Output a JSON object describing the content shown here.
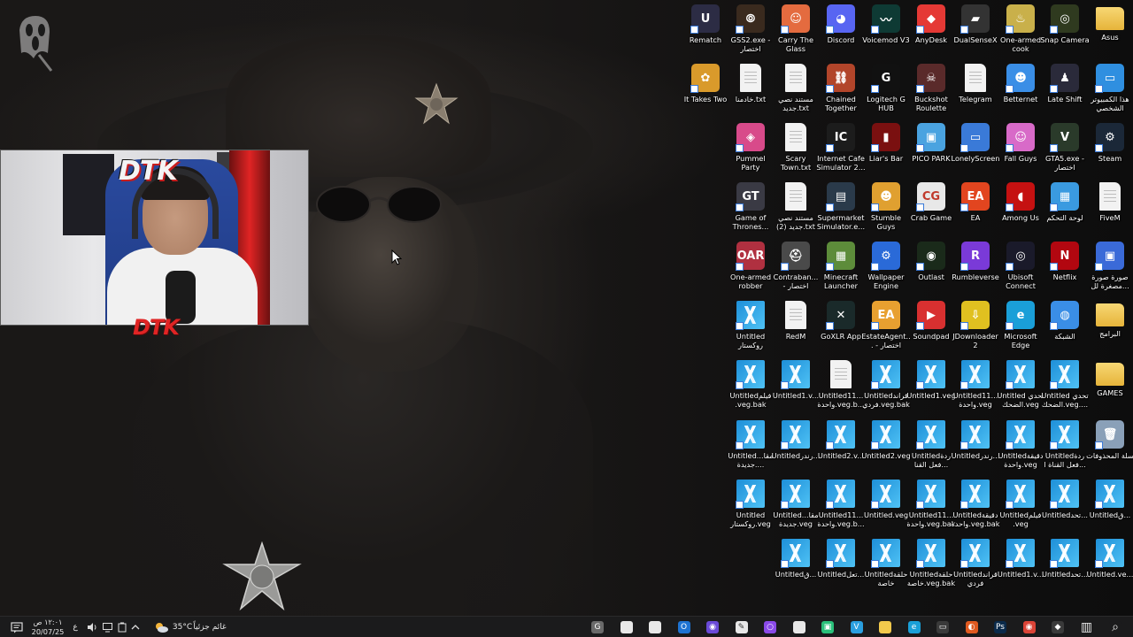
{
  "desktop": {
    "icons": [
      {
        "label": "Rematch",
        "kind": "app",
        "color": "#2c2c44",
        "glyph": "U",
        "col": 0,
        "row": 0
      },
      {
        "label": "GSS2.exe - اختصار",
        "kind": "app",
        "color": "#3a2a1e",
        "glyph": "⦾",
        "col": 1,
        "row": 0
      },
      {
        "label": "Carry The Glass",
        "kind": "app",
        "color": "#e46b3f",
        "glyph": "☺",
        "col": 2,
        "row": 0
      },
      {
        "label": "Discord",
        "kind": "app",
        "color": "#5865f2",
        "glyph": "◕",
        "col": 3,
        "row": 0
      },
      {
        "label": "Voicemod V3",
        "kind": "app",
        "color": "#0e3a34",
        "glyph": "〰",
        "col": 4,
        "row": 0
      },
      {
        "label": "AnyDesk",
        "kind": "app",
        "color": "#e53935",
        "glyph": "◆",
        "col": 5,
        "row": 0
      },
      {
        "label": "DualSenseX",
        "kind": "app",
        "color": "#333333",
        "glyph": "▰",
        "col": 6,
        "row": 0
      },
      {
        "label": "One-armed cook",
        "kind": "app",
        "color": "#c9b04a",
        "glyph": "♨",
        "col": 7,
        "row": 0
      },
      {
        "label": "Snap Camera",
        "kind": "app",
        "color": "#2f3a1f",
        "glyph": "◎",
        "col": 8,
        "row": 0
      },
      {
        "label": "Asus",
        "kind": "folder",
        "color": "#f2c94c",
        "glyph": "",
        "col": 9,
        "row": 0
      },
      {
        "label": "It Takes Two",
        "kind": "app",
        "color": "#d99a2b",
        "glyph": "✿",
        "col": 0,
        "row": 1
      },
      {
        "label": "خادمنا.txt",
        "kind": "doc",
        "color": "#f2f2f2",
        "glyph": "",
        "col": 1,
        "row": 1
      },
      {
        "label": "مستند نصي جديد.txt",
        "kind": "doc",
        "color": "#f2f2f2",
        "glyph": "",
        "col": 2,
        "row": 1
      },
      {
        "label": "Chained Together",
        "kind": "app",
        "color": "#b2452a",
        "glyph": "⛓",
        "col": 3,
        "row": 1
      },
      {
        "label": "Logitech G HUB",
        "kind": "app",
        "color": "#111111",
        "glyph": "G",
        "col": 4,
        "row": 1
      },
      {
        "label": "Buckshot Roulette",
        "kind": "app",
        "color": "#5a2a2a",
        "glyph": "☠",
        "col": 5,
        "row": 1
      },
      {
        "label": "Telegram",
        "kind": "doc",
        "color": "#f2f2f2",
        "glyph": "",
        "col": 6,
        "row": 1
      },
      {
        "label": "Betternet",
        "kind": "app",
        "color": "#3a8ee6",
        "glyph": "☻",
        "col": 7,
        "row": 1
      },
      {
        "label": "Late Shift",
        "kind": "app",
        "color": "#2a2a3a",
        "glyph": "♟",
        "col": 8,
        "row": 1
      },
      {
        "label": "هذا الكمبيوتر الشخصي",
        "kind": "app",
        "color": "#2f8fe0",
        "glyph": "▭",
        "col": 9,
        "row": 1
      },
      {
        "label": "Pummel Party",
        "kind": "app",
        "color": "#d84a8a",
        "glyph": "◈",
        "col": 0,
        "row": 2
      },
      {
        "label": "Scary Town.txt",
        "kind": "doc",
        "color": "#f2f2f2",
        "glyph": "",
        "col": 1,
        "row": 2
      },
      {
        "label": "Internet Cafe Simulator 2...",
        "kind": "app",
        "color": "#1c1c1c",
        "glyph": "IC",
        "col": 2,
        "row": 2
      },
      {
        "label": "Liar's Bar",
        "kind": "app",
        "color": "#7a1010",
        "glyph": "▮",
        "col": 3,
        "row": 2
      },
      {
        "label": "PICO PARK",
        "kind": "app",
        "color": "#4aa3e0",
        "glyph": "▣",
        "col": 4,
        "row": 2
      },
      {
        "label": "LonelyScreen",
        "kind": "app",
        "color": "#3a7ad8",
        "glyph": "▭",
        "col": 5,
        "row": 2
      },
      {
        "label": "Fall Guys",
        "kind": "app",
        "color": "#d86ac8",
        "glyph": "☺",
        "col": 6,
        "row": 2
      },
      {
        "label": "GTA5.exe - اختصار",
        "kind": "app",
        "color": "#2a3a2a",
        "glyph": "V",
        "col": 7,
        "row": 2
      },
      {
        "label": "Steam",
        "kind": "app",
        "color": "#1b2838",
        "glyph": "⚙",
        "col": 8,
        "row": 2
      },
      {
        "label": "Game of Thrones...",
        "kind": "app",
        "color": "#3a3a44",
        "glyph": "GT",
        "col": 0,
        "row": 3
      },
      {
        "label": "مستند نصي جديد (2).txt",
        "kind": "doc",
        "color": "#f2f2f2",
        "glyph": "",
        "col": 1,
        "row": 3
      },
      {
        "label": "Supermarket Simulator.e...",
        "kind": "app",
        "color": "#2a3a4a",
        "glyph": "▤",
        "col": 2,
        "row": 3
      },
      {
        "label": "Stumble Guys",
        "kind": "app",
        "color": "#e0a030",
        "glyph": "☻",
        "col": 3,
        "row": 3
      },
      {
        "label": "Crab Game",
        "kind": "app",
        "color": "#e8e8e8",
        "glyph": "CG",
        "col": 4,
        "row": 3
      },
      {
        "label": "EA",
        "kind": "app",
        "color": "#e2451f",
        "glyph": "EA",
        "col": 5,
        "row": 3
      },
      {
        "label": "Among Us",
        "kind": "app",
        "color": "#c51111",
        "glyph": "◖",
        "col": 6,
        "row": 3
      },
      {
        "label": "لوحة التحكم",
        "kind": "app",
        "color": "#3a9ae0",
        "glyph": "▦",
        "col": 7,
        "row": 3
      },
      {
        "label": "FiveM",
        "kind": "doc",
        "color": "#f2f2f2",
        "glyph": "",
        "col": 8,
        "row": 3
      },
      {
        "label": "One-armed robber",
        "kind": "app",
        "color": "#b03040",
        "glyph": "OAR",
        "col": 0,
        "row": 4
      },
      {
        "label": "Contraban... - اختصار",
        "kind": "app",
        "color": "#4a4a4a",
        "glyph": "⛑",
        "col": 1,
        "row": 4
      },
      {
        "label": "Minecraft Launcher",
        "kind": "app",
        "color": "#5d8c3a",
        "glyph": "▦",
        "col": 2,
        "row": 4
      },
      {
        "label": "Wallpaper Engine",
        "kind": "app",
        "color": "#2a6ad8",
        "glyph": "⚙",
        "col": 3,
        "row": 4
      },
      {
        "label": "Outlast",
        "kind": "app",
        "color": "#1a2a1a",
        "glyph": "◉",
        "col": 4,
        "row": 4
      },
      {
        "label": "Rumbleverse",
        "kind": "app",
        "color": "#7a3ad8",
        "glyph": "R",
        "col": 5,
        "row": 4
      },
      {
        "label": "Ubisoft Connect",
        "kind": "app",
        "color": "#1a1a2a",
        "glyph": "◎",
        "col": 6,
        "row": 4
      },
      {
        "label": "Netflix",
        "kind": "app",
        "color": "#b20710",
        "glyph": "N",
        "col": 7,
        "row": 4
      },
      {
        "label": "صورة صورة مصغرة لل...",
        "kind": "app",
        "color": "#3a6ad8",
        "glyph": "▣",
        "col": 8,
        "row": 4
      },
      {
        "label": "Untitled روكستار",
        "kind": "veg",
        "color": "",
        "glyph": "",
        "col": 0,
        "row": 5
      },
      {
        "label": "RedM",
        "kind": "doc",
        "color": "#f2f2f2",
        "glyph": "",
        "col": 1,
        "row": 5
      },
      {
        "label": "GoXLR App",
        "kind": "app",
        "color": "#1a2a2a",
        "glyph": "✕",
        "col": 2,
        "row": 5
      },
      {
        "label": "EstateAgent... - اختصار",
        "kind": "app",
        "color": "#e8a030",
        "glyph": "EA",
        "col": 3,
        "row": 5
      },
      {
        "label": "Soundpad",
        "kind": "app",
        "color": "#d83030",
        "glyph": "▶",
        "col": 4,
        "row": 5
      },
      {
        "label": "JDownloader 2",
        "kind": "app",
        "color": "#e0c020",
        "glyph": "⇩",
        "col": 5,
        "row": 5
      },
      {
        "label": "Microsoft Edge",
        "kind": "app",
        "color": "#1a9fd8",
        "glyph": "e",
        "col": 6,
        "row": 5
      },
      {
        "label": "الشبكة",
        "kind": "app",
        "color": "#3a8ee6",
        "glyph": "◍",
        "col": 7,
        "row": 5
      },
      {
        "label": "البرامج",
        "kind": "folder",
        "color": "#f2c94c",
        "glyph": "",
        "col": 8,
        "row": 5
      },
      {
        "label": "Untitledفيلم .veg.bak",
        "kind": "veg",
        "color": "",
        "glyph": "",
        "col": 0,
        "row": 6
      },
      {
        "label": "Untitled1.v...",
        "kind": "veg",
        "color": "",
        "glyph": "",
        "col": 1,
        "row": 6
      },
      {
        "label": "Untitled11... واحدة.veg.b...",
        "kind": "doc",
        "color": "#f2f2f2",
        "glyph": "",
        "col": 2,
        "row": 6
      },
      {
        "label": "Untitledقراند فردي.veg.bak",
        "kind": "veg",
        "color": "",
        "glyph": "",
        "col": 3,
        "row": 6
      },
      {
        "label": "Untitled1.veg",
        "kind": "veg",
        "color": "",
        "glyph": "",
        "col": 4,
        "row": 6
      },
      {
        "label": "Untitled11... واحدة.veg",
        "kind": "veg",
        "color": "",
        "glyph": "",
        "col": 5,
        "row": 6
      },
      {
        "label": "Untitled تحدي الضحك.veg",
        "kind": "veg",
        "color": "",
        "glyph": "",
        "col": 6,
        "row": 6
      },
      {
        "label": "Untitled تحدي الضحك.veg....",
        "kind": "veg",
        "color": "",
        "glyph": "",
        "col": 7,
        "row": 6
      },
      {
        "label": "GAMES",
        "kind": "folder",
        "color": "#f2c94c",
        "glyph": "",
        "col": 8,
        "row": 6
      },
      {
        "label": "Untitledمقا... جديدة....",
        "kind": "veg",
        "color": "",
        "glyph": "",
        "col": 0,
        "row": 7
      },
      {
        "label": "Untitledرندر...",
        "kind": "veg",
        "color": "",
        "glyph": "",
        "col": 1,
        "row": 7
      },
      {
        "label": "Untitled2.v...",
        "kind": "veg",
        "color": "",
        "glyph": "",
        "col": 2,
        "row": 7
      },
      {
        "label": "Untitled2.veg",
        "kind": "veg",
        "color": "",
        "glyph": "",
        "col": 3,
        "row": 7
      },
      {
        "label": "Untitledردة فعل القنا...",
        "kind": "veg",
        "color": "",
        "glyph": "",
        "col": 4,
        "row": 7
      },
      {
        "label": "Untitledرندر...",
        "kind": "veg",
        "color": "",
        "glyph": "",
        "col": 5,
        "row": 7
      },
      {
        "label": "Untitledدقيقة واحدة.veg",
        "kind": "veg",
        "color": "",
        "glyph": "",
        "col": 6,
        "row": 7
      },
      {
        "label": "Untitledردة فعل القناة ا...",
        "kind": "veg",
        "color": "",
        "glyph": "",
        "col": 7,
        "row": 7
      },
      {
        "label": "سلة المحذوفات",
        "kind": "app",
        "color": "#8aa0b8",
        "glyph": "🗑",
        "col": 8,
        "row": 7
      },
      {
        "label": "Untitled روكستار.veg",
        "kind": "veg",
        "color": "",
        "glyph": "",
        "col": 0,
        "row": 8
      },
      {
        "label": "Untitledمقا... جديدة.veg",
        "kind": "veg",
        "color": "",
        "glyph": "",
        "col": 1,
        "row": 8
      },
      {
        "label": "Untitled11... واحدة.veg.b...",
        "kind": "veg",
        "color": "",
        "glyph": "",
        "col": 2,
        "row": 8
      },
      {
        "label": "Untitled.veg",
        "kind": "veg",
        "color": "",
        "glyph": "",
        "col": 3,
        "row": 8
      },
      {
        "label": "Untitled11... واحدة.veg.bak",
        "kind": "veg",
        "color": "",
        "glyph": "",
        "col": 4,
        "row": 8
      },
      {
        "label": "Untitledدقيقة واحدة.veg.bak",
        "kind": "veg",
        "color": "",
        "glyph": "",
        "col": 5,
        "row": 8
      },
      {
        "label": "Untitledفيلم .veg",
        "kind": "veg",
        "color": "",
        "glyph": "",
        "col": 6,
        "row": 8
      },
      {
        "label": "Untitledتحد...",
        "kind": "veg",
        "color": "",
        "glyph": "",
        "col": 7,
        "row": 8
      },
      {
        "label": "Untitledق...",
        "kind": "veg",
        "color": "",
        "glyph": "",
        "col": 8,
        "row": 8
      },
      {
        "label": "Untitledق...",
        "kind": "veg",
        "color": "",
        "glyph": "",
        "col": 1,
        "row": 9
      },
      {
        "label": "Untitledتعل...",
        "kind": "veg",
        "color": "",
        "glyph": "",
        "col": 2,
        "row": 9
      },
      {
        "label": "Untitledحلقة خاصة",
        "kind": "veg",
        "color": "",
        "glyph": "",
        "col": 3,
        "row": 9
      },
      {
        "label": "Untitledحلقة خاصة.veg.bak",
        "kind": "veg",
        "color": "",
        "glyph": "",
        "col": 4,
        "row": 9
      },
      {
        "label": "Untitledقراند فردي",
        "kind": "veg",
        "color": "",
        "glyph": "",
        "col": 5,
        "row": 9
      },
      {
        "label": "Untitled1.v...",
        "kind": "veg",
        "color": "",
        "glyph": "",
        "col": 6,
        "row": 9
      },
      {
        "label": "Untitledتحد...",
        "kind": "veg",
        "color": "",
        "glyph": "",
        "col": 7,
        "row": 9
      },
      {
        "label": "Untitled.ve...",
        "kind": "veg",
        "color": "",
        "glyph": "",
        "col": 8,
        "row": 9
      }
    ]
  },
  "webcam": {
    "logo_top": "DTK",
    "logo_bottom": "DTK"
  },
  "taskbar": {
    "clock_time": "١٢:٠١ ص",
    "clock_date": "20/07/25",
    "lang": "ع",
    "weather_temp": "35°C",
    "weather_desc": "غائم جزئياً",
    "tray_icons": [
      "notification-icon",
      "volume-icon",
      "network-icon",
      "battery-icon",
      "task-icon",
      "chevron-up-icon"
    ],
    "apps": [
      {
        "name": "gaming-app",
        "color": "#6a6a6a",
        "glyph": "G"
      },
      {
        "name": "file-app",
        "color": "#e8e8e8",
        "glyph": ""
      },
      {
        "name": "file-app-2",
        "color": "#e8e8e8",
        "glyph": ""
      },
      {
        "name": "outlook-app",
        "color": "#1e73d2",
        "glyph": "O"
      },
      {
        "name": "app-purple",
        "color": "#6a4ad8",
        "glyph": "◉"
      },
      {
        "name": "notepad-app",
        "color": "#e8e8e8",
        "glyph": "✎"
      },
      {
        "name": "app-ring",
        "color": "#8a4ae8",
        "glyph": "○"
      },
      {
        "name": "file-app-3",
        "color": "#e8e8e8",
        "glyph": ""
      },
      {
        "name": "app-green",
        "color": "#2ac07a",
        "glyph": "▣"
      },
      {
        "name": "vegas-app",
        "color": "#2a9fe0",
        "glyph": "V"
      },
      {
        "name": "explorer-app",
        "color": "#f2c94c",
        "glyph": ""
      },
      {
        "name": "edge-app",
        "color": "#1aa0d8",
        "glyph": "e"
      },
      {
        "name": "xbox-app",
        "color": "#3a3a3a",
        "glyph": "▭"
      },
      {
        "name": "vpn-app",
        "color": "#e05a20",
        "glyph": "◐"
      },
      {
        "name": "photoshop-app",
        "color": "#0a2a4a",
        "glyph": "Ps"
      },
      {
        "name": "chrome-app",
        "color": "#db4437",
        "glyph": "◉"
      },
      {
        "name": "app-dark",
        "color": "#3a3a3a",
        "glyph": "◆"
      },
      {
        "name": "task-view",
        "color": "#1b1b1c",
        "glyph": "▥"
      },
      {
        "name": "search",
        "color": "#1b1b1c",
        "glyph": "⌕"
      },
      {
        "name": "start",
        "color": "#1b1b1c",
        "glyph": "⊞"
      }
    ]
  }
}
